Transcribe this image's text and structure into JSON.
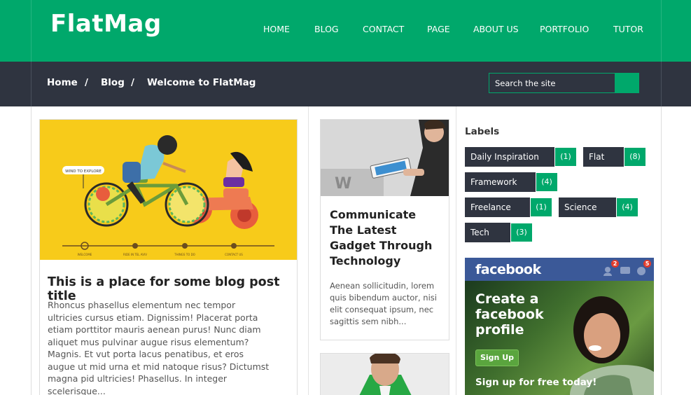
{
  "header": {
    "logo": "FlatMag",
    "nav": [
      "HOME",
      "BLOG",
      "CONTACT",
      "PAGE",
      "ABOUT US",
      "PORTFOLIO",
      "TUTOR"
    ]
  },
  "breadcrumb": {
    "items": [
      "Home",
      "Blog",
      "Welcome to FlatMag"
    ],
    "separator": "/"
  },
  "search": {
    "placeholder": "Search the site"
  },
  "posts": [
    {
      "title": "This is a place for some blog post title",
      "excerpt": "Rhoncus phasellus elementum nec tempor ultricies cursus etiam. Dignissim! Placerat porta etiam porttitor mauris aenean purus! Nunc diam aliquet mus pulvinar augue risus elementum? Magnis. Et vut porta lacus penatibus, et eros augue ut mid urna et mid natoque risus? Dictumst magna pid ultricies! Phasellus. In integer scelerisque..."
    },
    {
      "title": "Communicate The Latest Gadget Through Technology",
      "excerpt": "Aenean sollicitudin, lorem quis bibendum auctor, nisi elit consequat ipsum, nec sagittis sem nibh..."
    }
  ],
  "illustration": {
    "labels": [
      "WIND TO EXPLORE",
      "WELCOME",
      "RIDE IN TEL AVIV",
      "THINGS TO DO",
      "CONTACT US"
    ]
  },
  "sidebar": {
    "labels_title": "Labels",
    "labels": [
      {
        "name": "Daily Inspiration",
        "count": "(1)"
      },
      {
        "name": "Flat",
        "count": "(8)"
      },
      {
        "name": "Framework",
        "count": "(4)"
      },
      {
        "name": "Freelance",
        "count": "(1)"
      },
      {
        "name": "Science",
        "count": "(4)"
      },
      {
        "name": "Tech",
        "count": "(3)"
      }
    ],
    "facebook": {
      "brand": "facebook",
      "headline": "Create a facebook profile",
      "button": "Sign Up",
      "tagline": "Sign up for free today!",
      "badges": [
        "2",
        "5"
      ]
    }
  },
  "colors": {
    "accent": "#00a86b",
    "dark": "#2f3440",
    "facebook": "#3b5998",
    "illustration_bg": "#f7cb1a"
  }
}
